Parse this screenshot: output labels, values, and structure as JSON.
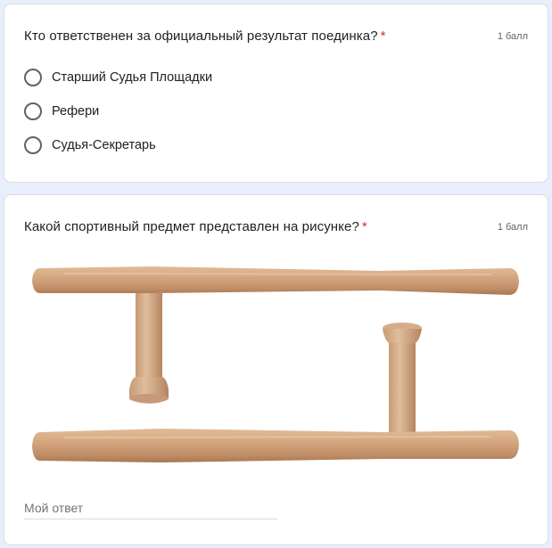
{
  "questions": [
    {
      "title": "Кто ответственен за официальный результат поединка?",
      "required_mark": "*",
      "points": "1 балл",
      "options": [
        "Старший Судья Площадки",
        "Рефери",
        "Судья-Секретарь"
      ]
    },
    {
      "title": "Какой спортивный предмет представлен на рисунке?",
      "required_mark": "*",
      "points": "1 балл",
      "answer_placeholder": "Мой ответ",
      "answer_value": ""
    }
  ],
  "colors": {
    "page_background": "#e8eefb",
    "required": "#d93025",
    "wood": "#d2a47e"
  },
  "icons": {
    "radio": "radio-unchecked-icon"
  }
}
